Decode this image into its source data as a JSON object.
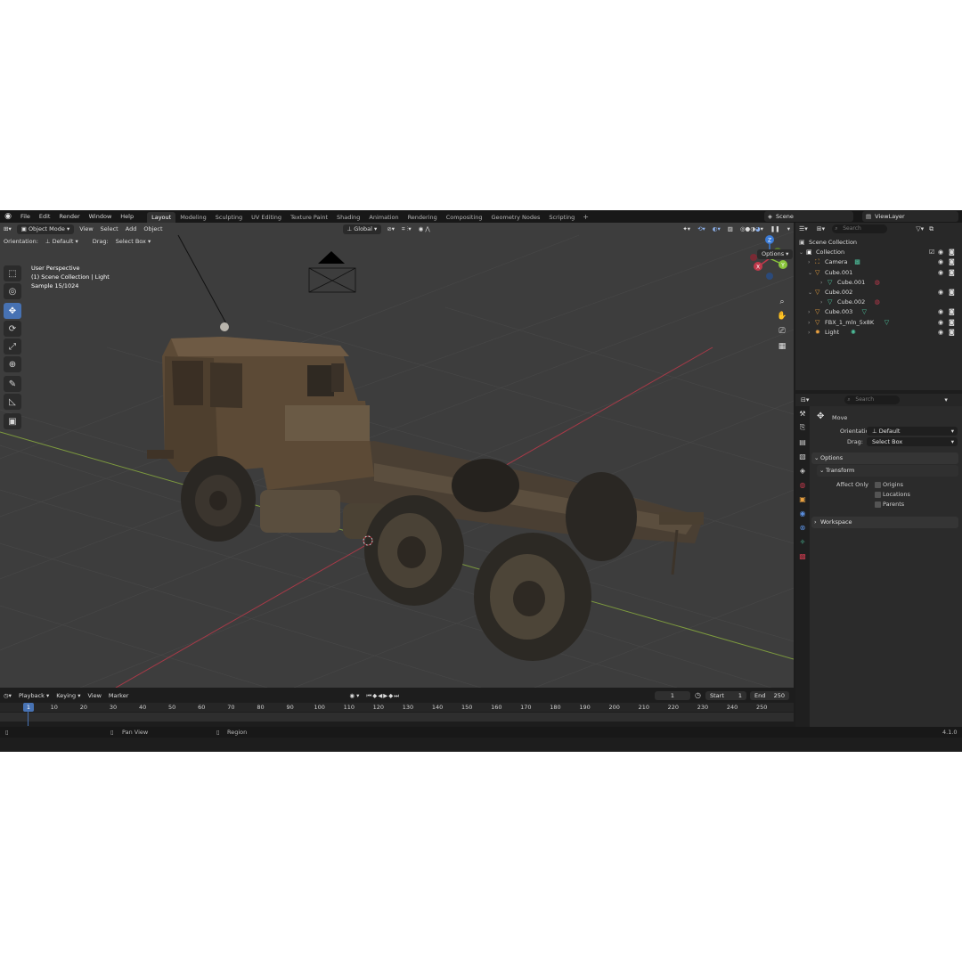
{
  "topbar": {
    "menus": [
      "File",
      "Edit",
      "Render",
      "Window",
      "Help"
    ],
    "workspaces": [
      "Layout",
      "Modeling",
      "Sculpting",
      "UV Editing",
      "Texture Paint",
      "Shading",
      "Animation",
      "Rendering",
      "Compositing",
      "Geometry Nodes",
      "Scripting"
    ],
    "active_workspace": "Layout",
    "add_tab": "+",
    "scene": "Scene",
    "view_layer": "ViewLayer"
  },
  "viewport": {
    "mode": "Object Mode",
    "menus": [
      "View",
      "Select",
      "Add",
      "Object"
    ],
    "transform_orientation": "Global",
    "orientation_label": "Orientation:",
    "orientation_value": "Default",
    "drag_label": "Drag:",
    "drag_value": "Select Box",
    "options": "Options",
    "overlay_lines": [
      "User Perspective",
      "(1) Scene Collection | Light",
      "Sample 15/1024"
    ],
    "gizmo_axes": [
      "Z",
      "X",
      "Y"
    ]
  },
  "timeline": {
    "menus": [
      "Playback",
      "Keying",
      "View",
      "Marker"
    ],
    "current_frame": "1",
    "start_label": "Start",
    "start": "1",
    "end_label": "End",
    "end": "250",
    "ticks": [
      "10",
      "20",
      "30",
      "40",
      "50",
      "60",
      "70",
      "80",
      "90",
      "100",
      "110",
      "120",
      "130",
      "140",
      "150",
      "160",
      "170",
      "180",
      "190",
      "200",
      "210",
      "220",
      "230",
      "240",
      "250"
    ]
  },
  "status": {
    "pan": "Pan View",
    "region": "Region",
    "version": "4.1.0"
  },
  "outliner": {
    "search_placeholder": "Search",
    "items": [
      {
        "name": "Scene Collection",
        "icon": "scene-collection-icon",
        "color": "#c8c8c8"
      },
      {
        "name": "Collection",
        "icon": "collection-icon",
        "color": "#ffffff"
      },
      {
        "name": "Camera",
        "icon": "camera-icon",
        "color": "#e8a040"
      },
      {
        "name": "Cube.001",
        "icon": "mesh-object-icon",
        "color": "#e8a040"
      },
      {
        "name": "Cube.001",
        "icon": "mesh-data-icon",
        "color": "#4fc6a0"
      },
      {
        "name": "Cube.002",
        "icon": "mesh-object-icon",
        "color": "#e8a040"
      },
      {
        "name": "Cube.002",
        "icon": "mesh-data-icon",
        "color": "#4fc6a0"
      },
      {
        "name": "Cube.003",
        "icon": "mesh-object-icon",
        "color": "#e8a040"
      },
      {
        "name": "FBX_1_mln_5x8K",
        "icon": "mesh-object-icon",
        "color": "#e8a040"
      },
      {
        "name": "Light",
        "icon": "light-icon",
        "color": "#e8a040"
      }
    ]
  },
  "properties": {
    "search_placeholder": "Search",
    "tool_name": "Move",
    "orientation_label": "Orientation",
    "orientation_value": "Default",
    "drag_label": "Drag:",
    "drag_value": "Select Box",
    "options_panel": "Options",
    "transform_panel": "Transform",
    "affect_only_label": "Affect Only",
    "affect_options": [
      "Origins",
      "Locations",
      "Parents"
    ],
    "workspace_panel": "Workspace"
  },
  "colors": {
    "accent": "#4772b3",
    "viewport_bg": "#3d3d3d",
    "panel_bg": "#2b2b2b",
    "axis_x": "#c0394b",
    "axis_y": "#8ac53c",
    "axis_z": "#3b7bd6"
  }
}
